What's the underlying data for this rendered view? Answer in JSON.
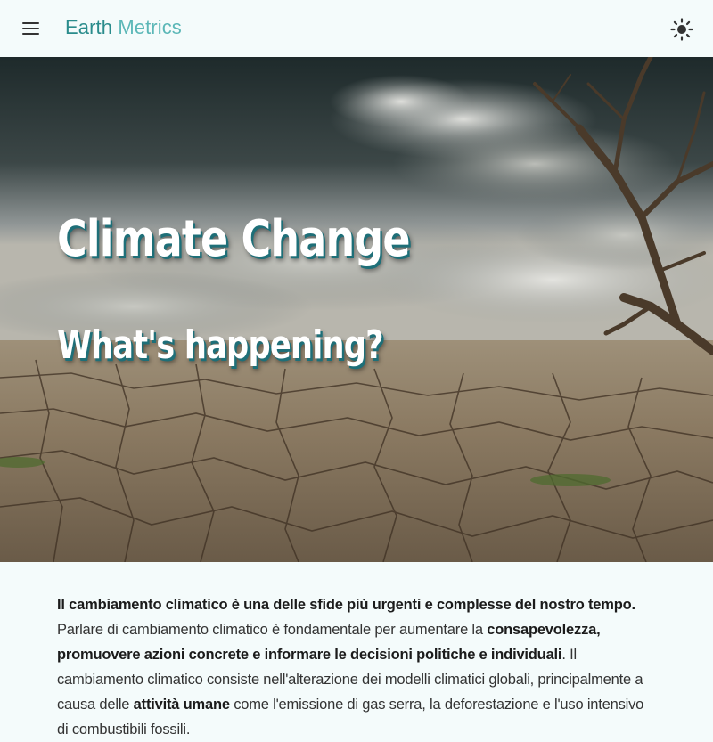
{
  "topbar": {
    "menu_icon": "hamburger-menu-icon",
    "brand_part1": "Earth",
    "brand_part2": "Metrics",
    "theme_icon": "sun-icon"
  },
  "hero": {
    "title": "Climate Change",
    "subtitle": "What's happening?",
    "image": "cracked-dry-earth-with-dead-tree"
  },
  "intro": {
    "lead": "Il cambiamento climatico è una delle sfide più urgenti e complesse del nostro tempo.",
    "t1": " Parlare di cambiamento climatico è fondamentale per aumentare la ",
    "b1": "consapevolezza, promuovere azioni concrete e informare le decisioni politiche e individuali",
    "t2": ". Il cambiamento climatico consiste nell'alterazione dei modelli climatici globali, principalmente a causa delle ",
    "b2": "attività umane",
    "t3": " come l'emissione di gas serra, la deforestazione e l'uso intensivo di combustibili fossili."
  },
  "colors": {
    "background": "#f4fbfb",
    "brand_dark": "#2a8c8c",
    "brand_light": "#5bb7b7",
    "title_shadow": "#1e6f78"
  }
}
